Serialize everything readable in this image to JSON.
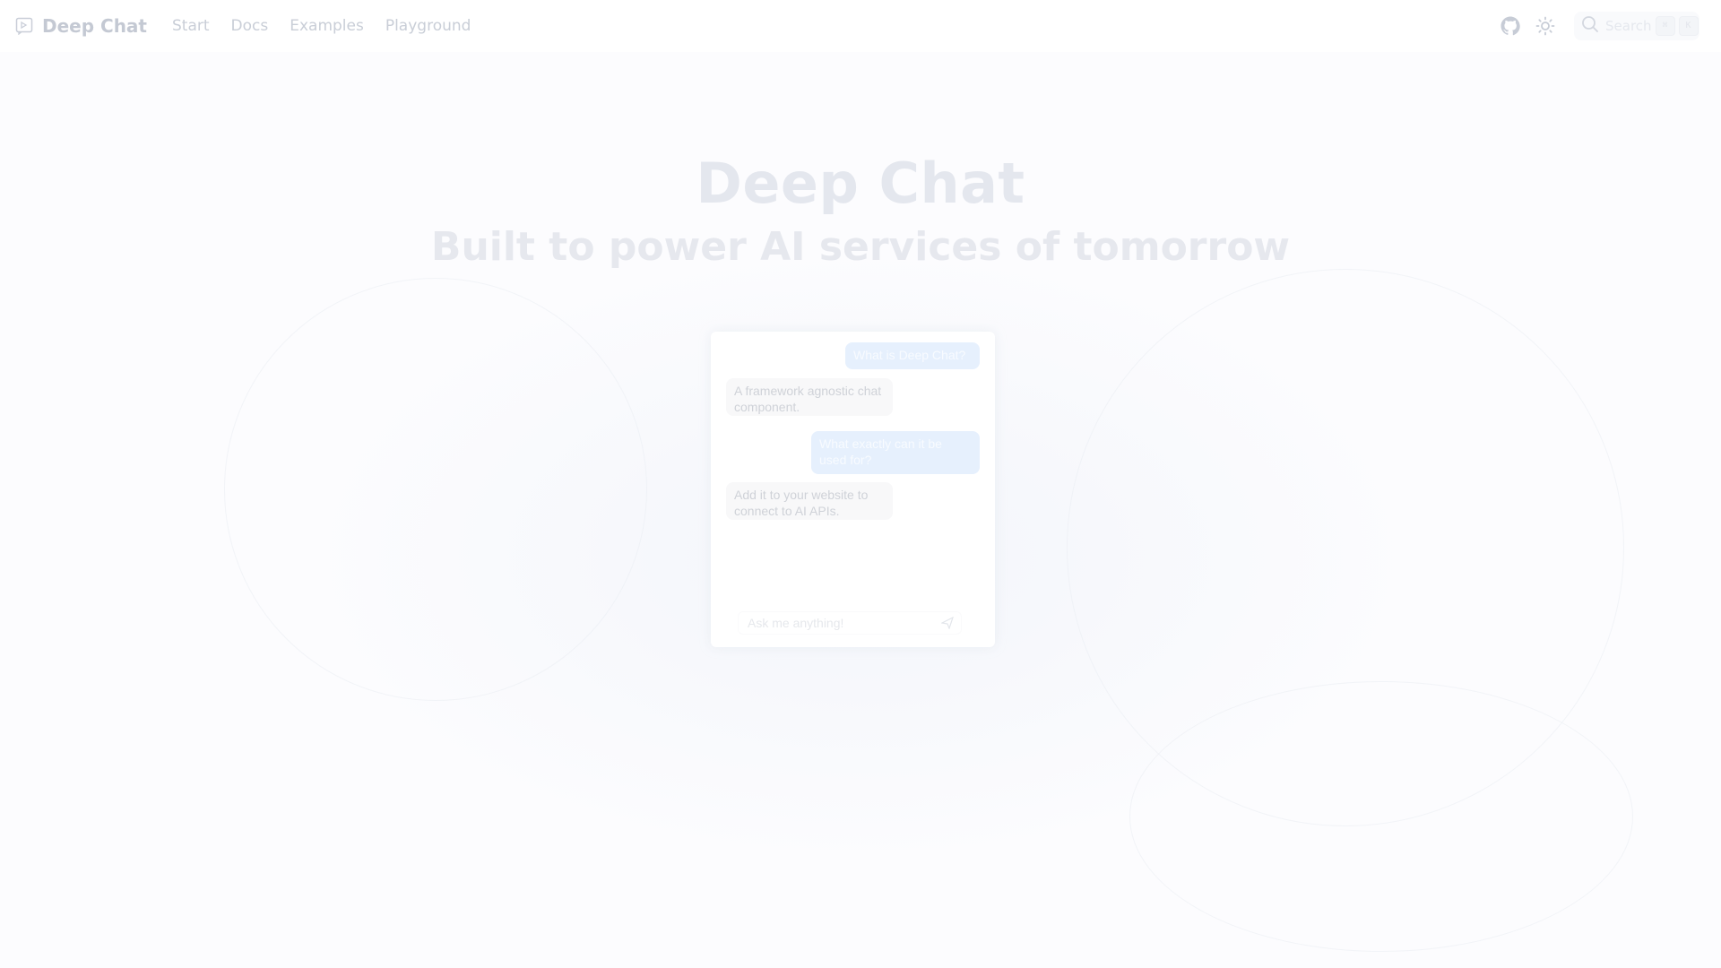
{
  "nav": {
    "brand": "Deep Chat",
    "links": [
      "Start",
      "Docs",
      "Examples",
      "Playground"
    ],
    "search_placeholder": "Search",
    "shortcut_keys": [
      "⌘",
      "K"
    ]
  },
  "hero": {
    "title": "Deep Chat",
    "subtitle": "Built to power AI services of tomorrow"
  },
  "chat": {
    "messages": [
      {
        "role": "user",
        "text": "What is Deep Chat?"
      },
      {
        "role": "ai",
        "text": "A framework agnostic chat component."
      },
      {
        "role": "user",
        "text": "What exactly can it be used for?"
      },
      {
        "role": "ai",
        "text": "Add it to your website to connect to AI APIs."
      }
    ],
    "input_placeholder": "Ask me anything!"
  },
  "icons": {
    "brand": "chat-logo-icon",
    "github": "github-icon",
    "theme": "sun-icon",
    "search": "search-icon",
    "send": "send-icon"
  },
  "colors": {
    "user_bubble": "#e6f0fd",
    "ai_bubble": "#f8f8f9",
    "background": "#fcfcfe"
  }
}
